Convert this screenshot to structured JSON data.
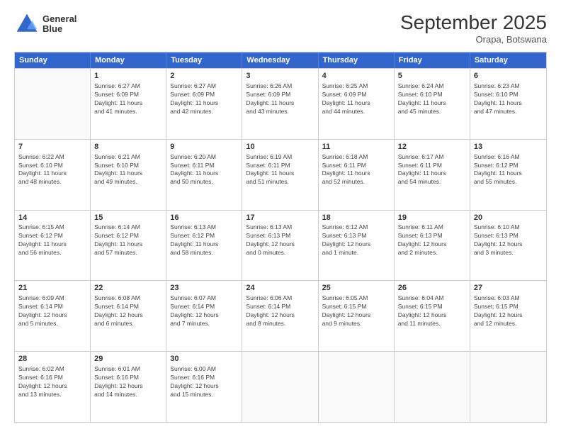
{
  "logo": {
    "line1": "General",
    "line2": "Blue"
  },
  "title": "September 2025",
  "subtitle": "Orapa, Botswana",
  "header_days": [
    "Sunday",
    "Monday",
    "Tuesday",
    "Wednesday",
    "Thursday",
    "Friday",
    "Saturday"
  ],
  "weeks": [
    [
      {
        "day": "",
        "info": ""
      },
      {
        "day": "1",
        "info": "Sunrise: 6:27 AM\nSunset: 6:09 PM\nDaylight: 11 hours\nand 41 minutes."
      },
      {
        "day": "2",
        "info": "Sunrise: 6:27 AM\nSunset: 6:09 PM\nDaylight: 11 hours\nand 42 minutes."
      },
      {
        "day": "3",
        "info": "Sunrise: 6:26 AM\nSunset: 6:09 PM\nDaylight: 11 hours\nand 43 minutes."
      },
      {
        "day": "4",
        "info": "Sunrise: 6:25 AM\nSunset: 6:09 PM\nDaylight: 11 hours\nand 44 minutes."
      },
      {
        "day": "5",
        "info": "Sunrise: 6:24 AM\nSunset: 6:10 PM\nDaylight: 11 hours\nand 45 minutes."
      },
      {
        "day": "6",
        "info": "Sunrise: 6:23 AM\nSunset: 6:10 PM\nDaylight: 11 hours\nand 47 minutes."
      }
    ],
    [
      {
        "day": "7",
        "info": "Sunrise: 6:22 AM\nSunset: 6:10 PM\nDaylight: 11 hours\nand 48 minutes."
      },
      {
        "day": "8",
        "info": "Sunrise: 6:21 AM\nSunset: 6:10 PM\nDaylight: 11 hours\nand 49 minutes."
      },
      {
        "day": "9",
        "info": "Sunrise: 6:20 AM\nSunset: 6:11 PM\nDaylight: 11 hours\nand 50 minutes."
      },
      {
        "day": "10",
        "info": "Sunrise: 6:19 AM\nSunset: 6:11 PM\nDaylight: 11 hours\nand 51 minutes."
      },
      {
        "day": "11",
        "info": "Sunrise: 6:18 AM\nSunset: 6:11 PM\nDaylight: 11 hours\nand 52 minutes."
      },
      {
        "day": "12",
        "info": "Sunrise: 6:17 AM\nSunset: 6:11 PM\nDaylight: 11 hours\nand 54 minutes."
      },
      {
        "day": "13",
        "info": "Sunrise: 6:16 AM\nSunset: 6:12 PM\nDaylight: 11 hours\nand 55 minutes."
      }
    ],
    [
      {
        "day": "14",
        "info": "Sunrise: 6:15 AM\nSunset: 6:12 PM\nDaylight: 11 hours\nand 56 minutes."
      },
      {
        "day": "15",
        "info": "Sunrise: 6:14 AM\nSunset: 6:12 PM\nDaylight: 11 hours\nand 57 minutes."
      },
      {
        "day": "16",
        "info": "Sunrise: 6:13 AM\nSunset: 6:12 PM\nDaylight: 11 hours\nand 58 minutes."
      },
      {
        "day": "17",
        "info": "Sunrise: 6:13 AM\nSunset: 6:13 PM\nDaylight: 12 hours\nand 0 minutes."
      },
      {
        "day": "18",
        "info": "Sunrise: 6:12 AM\nSunset: 6:13 PM\nDaylight: 12 hours\nand 1 minute."
      },
      {
        "day": "19",
        "info": "Sunrise: 6:11 AM\nSunset: 6:13 PM\nDaylight: 12 hours\nand 2 minutes."
      },
      {
        "day": "20",
        "info": "Sunrise: 6:10 AM\nSunset: 6:13 PM\nDaylight: 12 hours\nand 3 minutes."
      }
    ],
    [
      {
        "day": "21",
        "info": "Sunrise: 6:09 AM\nSunset: 6:14 PM\nDaylight: 12 hours\nand 5 minutes."
      },
      {
        "day": "22",
        "info": "Sunrise: 6:08 AM\nSunset: 6:14 PM\nDaylight: 12 hours\nand 6 minutes."
      },
      {
        "day": "23",
        "info": "Sunrise: 6:07 AM\nSunset: 6:14 PM\nDaylight: 12 hours\nand 7 minutes."
      },
      {
        "day": "24",
        "info": "Sunrise: 6:06 AM\nSunset: 6:14 PM\nDaylight: 12 hours\nand 8 minutes."
      },
      {
        "day": "25",
        "info": "Sunrise: 6:05 AM\nSunset: 6:15 PM\nDaylight: 12 hours\nand 9 minutes."
      },
      {
        "day": "26",
        "info": "Sunrise: 6:04 AM\nSunset: 6:15 PM\nDaylight: 12 hours\nand 11 minutes."
      },
      {
        "day": "27",
        "info": "Sunrise: 6:03 AM\nSunset: 6:15 PM\nDaylight: 12 hours\nand 12 minutes."
      }
    ],
    [
      {
        "day": "28",
        "info": "Sunrise: 6:02 AM\nSunset: 6:16 PM\nDaylight: 12 hours\nand 13 minutes."
      },
      {
        "day": "29",
        "info": "Sunrise: 6:01 AM\nSunset: 6:16 PM\nDaylight: 12 hours\nand 14 minutes."
      },
      {
        "day": "30",
        "info": "Sunrise: 6:00 AM\nSunset: 6:16 PM\nDaylight: 12 hours\nand 15 minutes."
      },
      {
        "day": "",
        "info": ""
      },
      {
        "day": "",
        "info": ""
      },
      {
        "day": "",
        "info": ""
      },
      {
        "day": "",
        "info": ""
      }
    ]
  ]
}
